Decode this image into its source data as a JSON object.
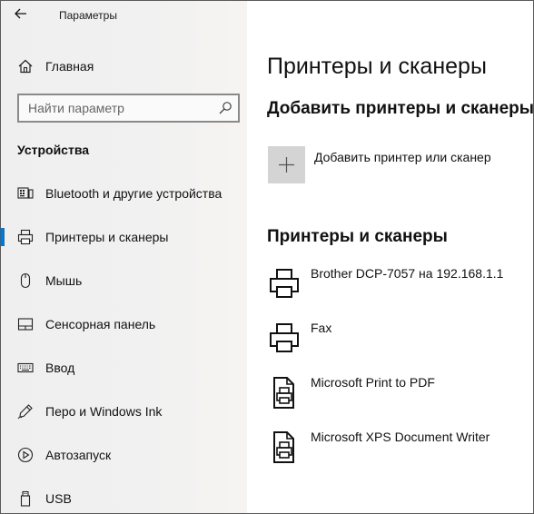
{
  "window": {
    "app_title": "Параметры"
  },
  "sidebar": {
    "home_label": "Главная",
    "search": {
      "placeholder": "Найти параметр"
    },
    "section_title": "Устройства",
    "items": [
      {
        "label": "Bluetooth и другие устройства",
        "icon": "bluetooth-devices-icon"
      },
      {
        "label": "Принтеры и сканеры",
        "icon": "printer-icon",
        "active": true
      },
      {
        "label": "Мышь",
        "icon": "mouse-icon"
      },
      {
        "label": "Сенсорная панель",
        "icon": "touchpad-icon"
      },
      {
        "label": "Ввод",
        "icon": "keyboard-icon"
      },
      {
        "label": "Перо и Windows Ink",
        "icon": "pen-icon"
      },
      {
        "label": "Автозапуск",
        "icon": "autoplay-icon"
      },
      {
        "label": "USB",
        "icon": "usb-icon"
      }
    ]
  },
  "main": {
    "page_title": "Принтеры и сканеры",
    "add_section_title": "Добавить принтеры и сканеры",
    "add_button_label": "Добавить принтер или сканер",
    "printers_section_title": "Принтеры и сканеры",
    "printers": [
      {
        "name": "Brother DCP-7057 на 192.168.1.1",
        "icon": "printer-icon"
      },
      {
        "name": "Fax",
        "icon": "printer-icon"
      },
      {
        "name": "Microsoft Print to PDF",
        "icon": "document-printer-icon"
      },
      {
        "name": "Microsoft XPS Document Writer",
        "icon": "document-printer-icon"
      }
    ]
  },
  "colors": {
    "accent": "#0078d7",
    "sidebar_bg": "#f0f0f0",
    "add_tile_bg": "#d4d4d4"
  }
}
